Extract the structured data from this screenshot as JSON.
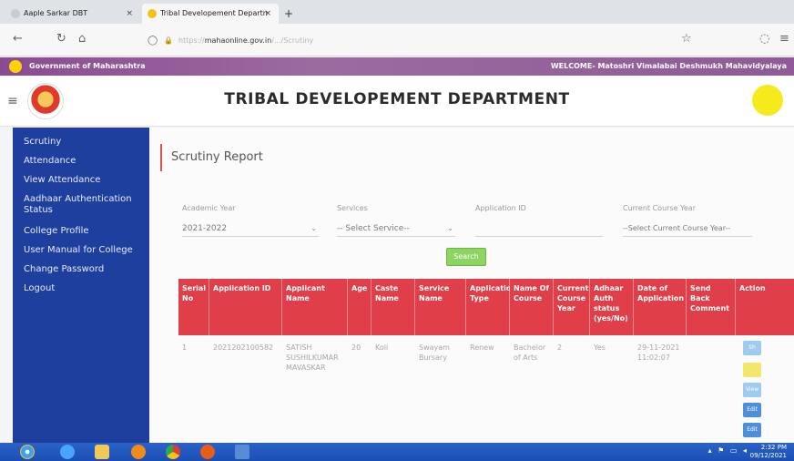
{
  "browser": {
    "tabs": [
      {
        "label": "Aaple Sarkar DBT"
      },
      {
        "label": "Tribal Developement Departn"
      }
    ],
    "tab_close": "×",
    "new_tab": "+",
    "url_prefix": "https://",
    "url_host": "mahaonline.gov.in",
    "url_suffix": "/.../Scrutiny"
  },
  "gov_bar": {
    "left_text": "Government of Maharashtra",
    "welcome_text": "WELCOME- Matoshri Vimalabai Deshmukh Mahavidyalaya"
  },
  "header": {
    "title": "TRIBAL DEVELOPEMENT DEPARTMENT"
  },
  "sidebar": {
    "items": [
      {
        "label": "Scrutiny"
      },
      {
        "label": "Attendance"
      },
      {
        "label": "View Attendance"
      },
      {
        "label": "Aadhaar Authentication Status"
      },
      {
        "label": "College Profile"
      },
      {
        "label": "User Manual for College"
      },
      {
        "label": "Change Password"
      },
      {
        "label": "Logout"
      }
    ]
  },
  "report": {
    "title": "Scrutiny Report",
    "filters": {
      "academic_year_label": "Academic Year",
      "academic_year_value": "2021-2022",
      "services_label": "Services",
      "services_value": "-- Select Service--",
      "application_id_label": "Application ID",
      "current_course_label": "Current Course Year",
      "current_course_value": "--Select Current Course Year--"
    },
    "search_label": "Search",
    "columns": [
      "Serial No",
      "Application ID",
      "Applicant Name",
      "Age",
      "Caste Name",
      "Service Name",
      "Application Type",
      "Name Of Course",
      "Current Course Year",
      "Adhaar Auth status (yes/No)",
      "Date of Application",
      "Send Back Comment",
      "Action"
    ],
    "rows": [
      {
        "serial": "1",
        "application_id": "2021202100582",
        "applicant_name": "SATISH SUSHILKUMAR MAVASKAR",
        "age": "20",
        "caste_name": "Koli",
        "service_name": "Swayam Bursary",
        "application_type": "Renew",
        "course": "Bachelor of Arts",
        "course_year": "2",
        "aadhaar_status": "Yes",
        "date": "29-11-2021 11:02:07",
        "comment": "",
        "actions": [
          {
            "label": "Sh",
            "color": "#9ecbee"
          },
          {
            "label": "",
            "color": "#f2e66c"
          },
          {
            "label": "View",
            "color": "#9ecbee"
          },
          {
            "label": "Edit",
            "color": "#4f8fd9"
          },
          {
            "label": "Edit",
            "color": "#4f8fd9"
          }
        ]
      }
    ]
  },
  "taskbar": {
    "time": "2:32 PM",
    "date": "09/12/2021"
  },
  "colors": {
    "sidebar": "#1e3f9e",
    "table_header": "#e03e48",
    "gov_bar": "#8a4b93",
    "search_button": "#8ed462",
    "taskbar": "#1b4fb4"
  }
}
